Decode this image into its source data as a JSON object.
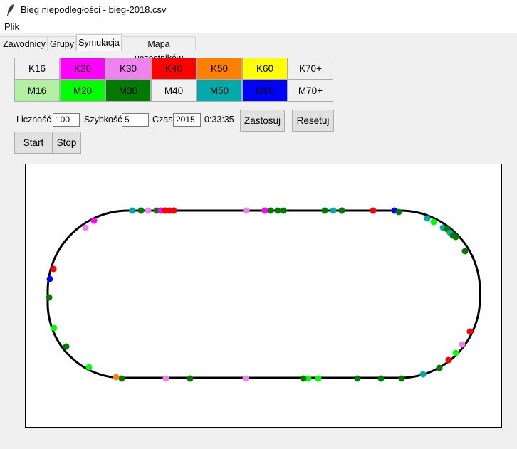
{
  "window": {
    "title": "Bieg niepodległości - bieg-2018.csv"
  },
  "menu": {
    "items": [
      "Plik"
    ]
  },
  "tabs": [
    {
      "label": "Zawodnicy",
      "active": false
    },
    {
      "label": "Grupy",
      "active": false
    },
    {
      "label": "Symulacja",
      "active": true
    },
    {
      "label": "Mapa uczestników",
      "active": false
    }
  ],
  "groups": {
    "women": [
      {
        "label": "K16",
        "color": "#f0f0f0"
      },
      {
        "label": "K20",
        "color": "#ff00ff"
      },
      {
        "label": "K30",
        "color": "#ee82ee"
      },
      {
        "label": "K40",
        "color": "#ff0000"
      },
      {
        "label": "K50",
        "color": "#ff8000"
      },
      {
        "label": "K60",
        "color": "#ffff00"
      },
      {
        "label": "K70+",
        "color": "#f0f0f0"
      }
    ],
    "men": [
      {
        "label": "M16",
        "color": "#b0f0a0"
      },
      {
        "label": "M20",
        "color": "#00ff00"
      },
      {
        "label": "M30",
        "color": "#007a00"
      },
      {
        "label": "M40",
        "color": "#f0f0f0"
      },
      {
        "label": "M50",
        "color": "#00aaaa"
      },
      {
        "label": "M60",
        "color": "#0000ff"
      },
      {
        "label": "M70+",
        "color": "#f0f0f0"
      }
    ]
  },
  "controls": {
    "count_label": "Liczność",
    "count_value": "100",
    "speed_label": "Szybkość",
    "speed_value": "5",
    "time_label": "Czas",
    "time_value": "2015",
    "elapsed": "0:33:35",
    "apply_button": "Zastosuj",
    "reset_button": "Resetuj",
    "start_button": "Start",
    "stop_button": "Stop"
  },
  "runners": [
    {
      "color": "#00aaaa"
    },
    {
      "color": "#007a00"
    },
    {
      "color": "#ee82ee"
    },
    {
      "color": "#007a00"
    },
    {
      "color": "#ff00ff"
    },
    {
      "color": "#ff0000"
    },
    {
      "color": "#ff0000"
    },
    {
      "color": "#ff0000"
    },
    {
      "color": "#ee82ee"
    },
    {
      "color": "#ff00ff"
    },
    {
      "color": "#007a00"
    },
    {
      "color": "#007a00"
    },
    {
      "color": "#007a00"
    },
    {
      "color": "#007a00"
    },
    {
      "color": "#00aaaa"
    },
    {
      "color": "#007a00"
    },
    {
      "color": "#ff0000"
    },
    {
      "color": "#0000ff"
    },
    {
      "color": "#007a00"
    },
    {
      "color": "#00aaaa"
    },
    {
      "color": "#00ff00"
    },
    {
      "color": "#00aaaa"
    },
    {
      "color": "#007a00"
    },
    {
      "color": "#00aaaa"
    },
    {
      "color": "#007a00"
    },
    {
      "color": "#007a00"
    },
    {
      "color": "#007a00"
    },
    {
      "color": "#ff0000"
    },
    {
      "color": "#ee82ee"
    },
    {
      "color": "#00ff00"
    },
    {
      "color": "#ff0000"
    },
    {
      "color": "#007a00"
    },
    {
      "color": "#00aaaa"
    },
    {
      "color": "#007a00"
    },
    {
      "color": "#007a00"
    },
    {
      "color": "#007a00"
    },
    {
      "color": "#00ff00"
    },
    {
      "color": "#00ff00"
    },
    {
      "color": "#007a00"
    },
    {
      "color": "#ee82ee"
    },
    {
      "color": "#007a00"
    },
    {
      "color": "#ee82ee"
    },
    {
      "color": "#007a00"
    },
    {
      "color": "#00ff00"
    },
    {
      "color": "#ff8000"
    },
    {
      "color": "#007a00"
    },
    {
      "color": "#00ff00"
    },
    {
      "color": "#007a00"
    },
    {
      "color": "#0000ff"
    },
    {
      "color": "#ff0000"
    },
    {
      "color": "#ee82ee"
    },
    {
      "color": "#ff00ff"
    },
    {
      "color": "#00aaaa"
    },
    {
      "color": "#b0f0a0"
    }
  ]
}
